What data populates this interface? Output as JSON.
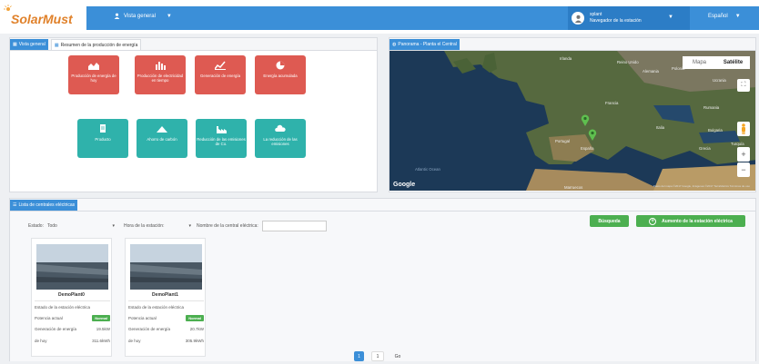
{
  "brand": {
    "logo_text": "SolarMust"
  },
  "header": {
    "nav_overview": "Vista general",
    "user_name": "xplant",
    "user_role": "Navegador de la estación",
    "language": "Español"
  },
  "overview_panel": {
    "tabs": [
      "Vista general",
      "Resumen de la producción de energía"
    ],
    "tiles_top": [
      "Producción de energía de hoy",
      "Producción de electricidad en tiempo",
      "Generación de energía",
      "Energía acumulada"
    ],
    "tiles_bottom": [
      "Producto",
      "Ahorro de carbón",
      "Reducción de las emisiones de Co.",
      "La reducción de las emisiones"
    ]
  },
  "map_panel": {
    "tab": "Panorama - Planta el Central",
    "toggle_map": "Mapa",
    "toggle_satellite": "Satélite",
    "google_label": "Google",
    "copyright": "Datos del mapa ©2017 Google, Imágenes ©2017 TerraMetrics  Términos de uso",
    "labels": [
      "Irlanda",
      "Reino Unido",
      "Alemania",
      "Polonia",
      "Ucrania",
      "Francia",
      "Rumania",
      "Italia",
      "Bulgaria",
      "Portugal",
      "España",
      "Grecia",
      "Turquía",
      "Marruecos",
      "Atlantic Ocean"
    ]
  },
  "list_panel": {
    "tab": "Lista de centrales eléctricas",
    "filter_state_label": "Estado:",
    "filter_state_value": "Todo",
    "filter_time_label": "Hora de la estación:",
    "filter_name_label": "Nombre de la central eléctrica:",
    "btn_search": "Búsqueda",
    "btn_add": "Aumento de la estación eléctrica",
    "cards": [
      {
        "name": "DemoPlant0",
        "status_label": "Estado de la estación eléctrica",
        "power_label": "Potencia actual",
        "power_badge": "Normal",
        "gen_label": "Generación de energía",
        "gen_value": "19.5kW",
        "today_label": "de hoy",
        "today_value": "311.6kWh"
      },
      {
        "name": "DemoPlant1",
        "status_label": "Estado de la estación eléctrica",
        "power_label": "Potencia actual",
        "power_badge": "Normal",
        "gen_label": "Generación de energía",
        "gen_value": "20.7kW",
        "today_label": "de hoy",
        "today_value": "305.9kWh"
      }
    ],
    "pagination": {
      "current": "1",
      "page_input": "1",
      "go": "Go"
    }
  },
  "colors": {
    "primary": "#3b8fd8",
    "tile_red": "#de5a52",
    "tile_teal": "#2fb2ab",
    "green": "#4caf50",
    "marker": "#5fbf4f"
  }
}
